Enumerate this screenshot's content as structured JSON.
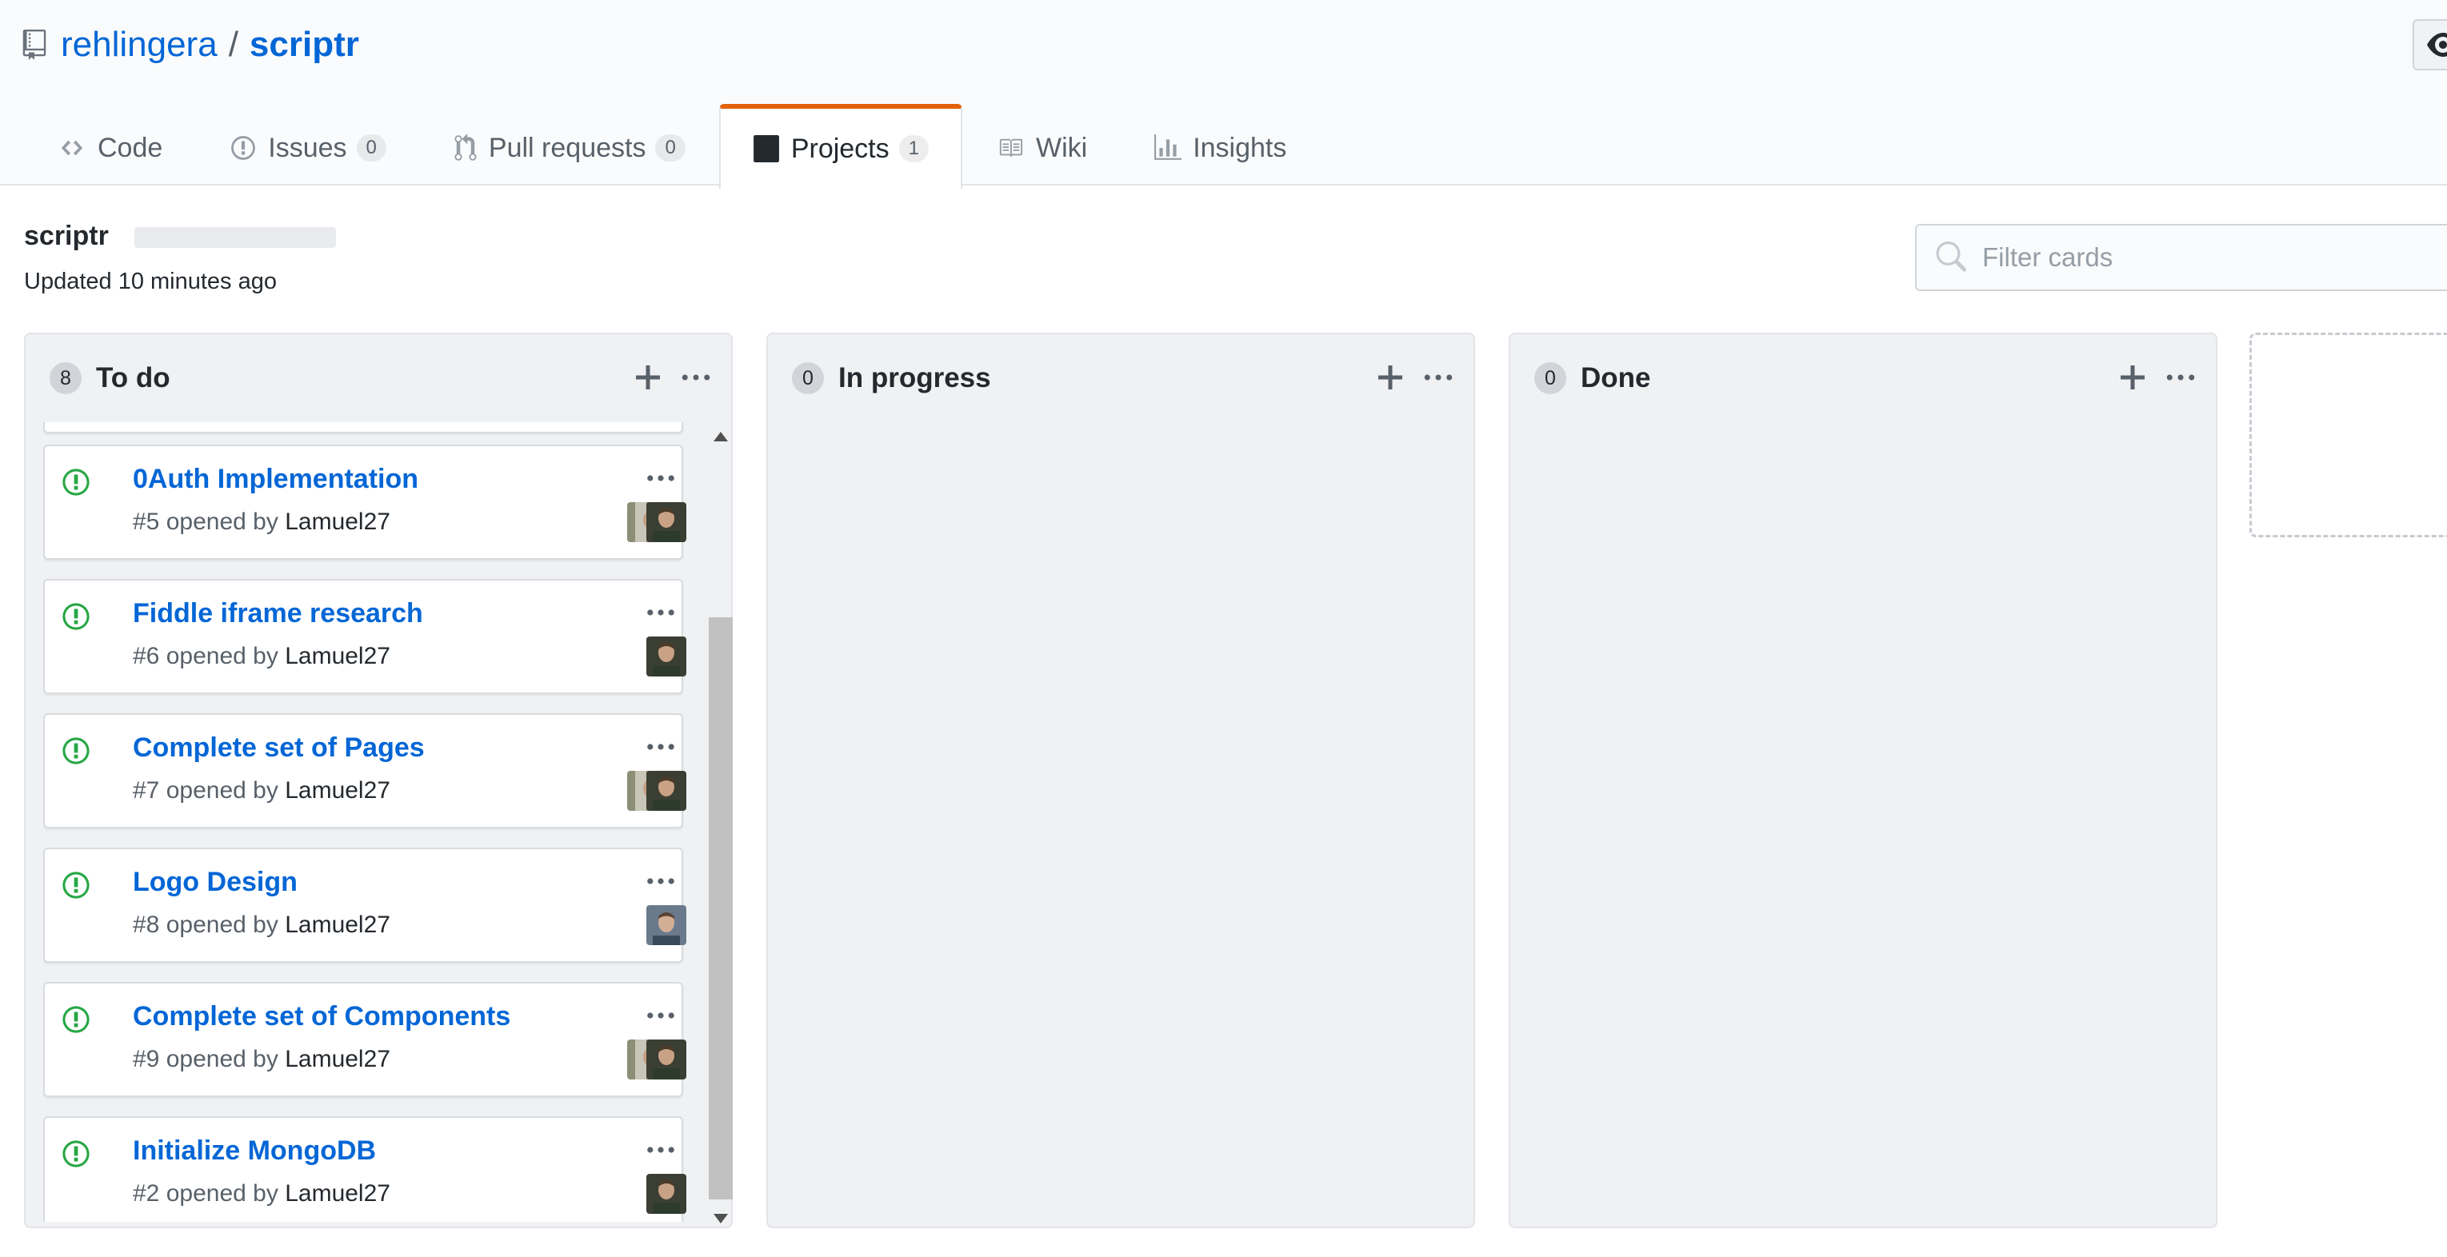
{
  "repo": {
    "owner": "rehlingera",
    "separator": "/",
    "name": "scriptr"
  },
  "tabs": [
    {
      "label": "Code",
      "icon": "code-icon"
    },
    {
      "label": "Issues",
      "count": "0",
      "icon": "issue-opened-icon"
    },
    {
      "label": "Pull requests",
      "count": "0",
      "icon": "git-pull-request-icon"
    },
    {
      "label": "Projects",
      "count": "1",
      "icon": "project-icon",
      "selected": true
    },
    {
      "label": "Wiki",
      "icon": "book-icon"
    },
    {
      "label": "Insights",
      "icon": "graph-icon"
    }
  ],
  "project": {
    "name": "scriptr",
    "updated": "Updated 10 minutes ago",
    "filter_placeholder": "Filter cards"
  },
  "columns": [
    {
      "title": "To do",
      "count": "8",
      "cards": [
        {
          "title": "0Auth Implementation",
          "number": "#5",
          "opened_by": "opened by",
          "author": "Lamuel27",
          "avatars": 2
        },
        {
          "title": "Fiddle iframe research",
          "number": "#6",
          "opened_by": "opened by",
          "author": "Lamuel27",
          "avatars": 1
        },
        {
          "title": "Complete set of Pages",
          "number": "#7",
          "opened_by": "opened by",
          "author": "Lamuel27",
          "avatars": 2
        },
        {
          "title": "Logo Design",
          "number": "#8",
          "opened_by": "opened by",
          "author": "Lamuel27",
          "avatars": 1
        },
        {
          "title": "Complete set of Components",
          "number": "#9",
          "opened_by": "opened by",
          "author": "Lamuel27",
          "avatars": 2
        },
        {
          "title": "Initialize MongoDB",
          "number": "#2",
          "opened_by": "opened by",
          "author": "Lamuel27",
          "avatars": 1
        }
      ]
    },
    {
      "title": "In progress",
      "count": "0",
      "cards": []
    },
    {
      "title": "Done",
      "count": "0",
      "cards": []
    }
  ],
  "colors": {
    "link": "#0366d6",
    "issue_open": "#28a745",
    "tab_accent": "#e36209",
    "column_bg": "#eff1f3"
  }
}
